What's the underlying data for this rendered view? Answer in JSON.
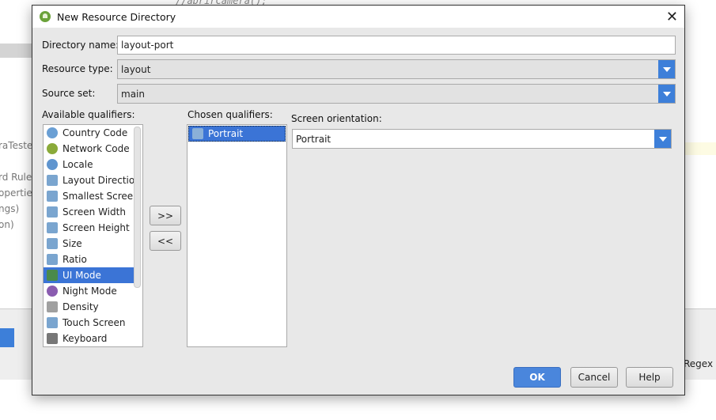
{
  "background": {
    "code_line": "//abrirCamera();",
    "side_items": [
      "raTestes)",
      "rd Rules",
      "operties",
      "ngs)",
      "on)"
    ],
    "regex_label": "Regex"
  },
  "dialog": {
    "title": "New Resource Directory",
    "directory_name": {
      "label": "Directory name:",
      "value": "layout-port"
    },
    "resource_type": {
      "label": "Resource type:",
      "value": "layout"
    },
    "source_set": {
      "label": "Source set:",
      "value": "main"
    },
    "available_qualifiers": {
      "label": "Available qualifiers:",
      "items": [
        {
          "label": "Country Code",
          "icon": "globe-sim-icon"
        },
        {
          "label": "Network Code",
          "icon": "network-sim-icon"
        },
        {
          "label": "Locale",
          "icon": "globe-icon"
        },
        {
          "label": "Layout Direction",
          "icon": "layout-direction-icon"
        },
        {
          "label": "Smallest Screen W",
          "icon": "smallest-screen-icon"
        },
        {
          "label": "Screen Width",
          "icon": "screen-width-icon"
        },
        {
          "label": "Screen Height",
          "icon": "screen-height-icon"
        },
        {
          "label": "Size",
          "icon": "size-icon"
        },
        {
          "label": "Ratio",
          "icon": "ratio-icon"
        },
        {
          "label": "UI Mode",
          "icon": "ui-mode-icon",
          "selected": true
        },
        {
          "label": "Night Mode",
          "icon": "night-mode-icon"
        },
        {
          "label": "Density",
          "icon": "density-icon"
        },
        {
          "label": "Touch Screen",
          "icon": "touch-screen-icon"
        },
        {
          "label": "Keyboard",
          "icon": "keyboard-icon"
        }
      ]
    },
    "add_button": ">>",
    "remove_button": "<<",
    "chosen_qualifiers": {
      "label": "Chosen qualifiers:",
      "items": [
        {
          "label": "Portrait",
          "selected": true
        }
      ]
    },
    "screen_orientation": {
      "label": "Screen orientation:",
      "value": "Portrait"
    },
    "ok": "OK",
    "cancel": "Cancel",
    "help": "Help"
  },
  "colors": {
    "accent": "#3d7fd9",
    "selection": "#3b74d6"
  }
}
